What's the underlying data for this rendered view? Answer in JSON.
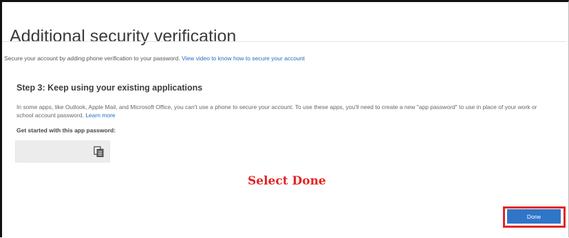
{
  "page": {
    "title": "Additional security verification",
    "intro_text": "Secure your account by adding phone verification to your password.",
    "intro_link": "View video to know how to secure your account"
  },
  "step": {
    "title": "Step 3: Keep using your existing applications",
    "description": "In some apps, like Outlook, Apple Mail, and Microsoft Office, you can't use a phone to secure your account. To use these apps, you'll need to create a new \"app password\" to use in place of your work or school account password.",
    "learn_more": "Learn more",
    "get_started_label": "Get started with this app password:",
    "password_value": ""
  },
  "annotation": {
    "text": "Select Done"
  },
  "actions": {
    "done_label": "Done"
  },
  "icons": {
    "copy": "copy-icon"
  },
  "colors": {
    "link": "#1f6fc0",
    "button": "#2f76c9",
    "annotation": "#e52222"
  }
}
